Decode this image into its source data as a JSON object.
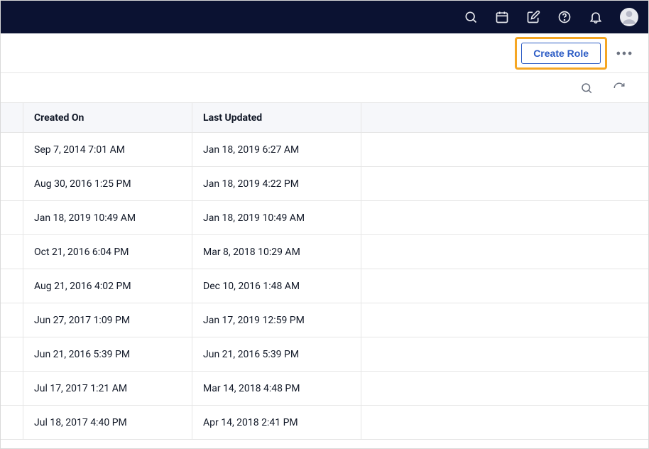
{
  "header": {
    "create_role_label": "Create Role"
  },
  "table": {
    "columns": {
      "created_on": "Created On",
      "last_updated": "Last Updated"
    },
    "rows": [
      {
        "created": "Sep 7, 2014 7:01 AM",
        "updated": "Jan 18, 2019 6:27 AM"
      },
      {
        "created": "Aug 30, 2016 1:25 PM",
        "updated": "Jan 18, 2019 4:22 PM"
      },
      {
        "created": "Jan 18, 2019 10:49 AM",
        "updated": "Jan 18, 2019 10:49 AM"
      },
      {
        "created": "Oct 21, 2016 6:04 PM",
        "updated": "Mar 8, 2018 10:29 AM"
      },
      {
        "created": "Aug 21, 2016 4:02 PM",
        "updated": "Dec 10, 2016 1:48 AM"
      },
      {
        "created": "Jun 27, 2017 1:09 PM",
        "updated": "Jan 17, 2019 12:59 PM"
      },
      {
        "created": "Jun 21, 2016 5:39 PM",
        "updated": "Jun 21, 2016 5:39 PM"
      },
      {
        "created": "Jul 17, 2017 1:21 AM",
        "updated": "Mar 14, 2018 4:48 PM"
      },
      {
        "created": "Jul 18, 2017 4:40 PM",
        "updated": "Apr 14, 2018 2:41 PM"
      }
    ]
  }
}
